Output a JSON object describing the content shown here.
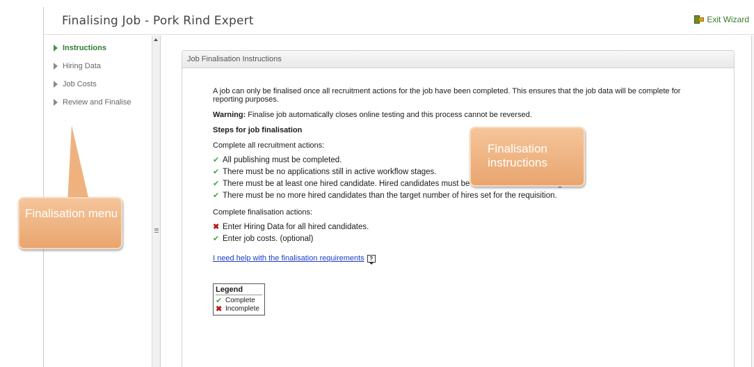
{
  "header": {
    "title": "Finalising Job - Pork Rind Expert",
    "exit_label": "Exit Wizard"
  },
  "sidebar": {
    "items": [
      {
        "label": "Instructions",
        "active": true
      },
      {
        "label": "Hiring Data",
        "active": false
      },
      {
        "label": "Job Costs",
        "active": false
      },
      {
        "label": "Review and Finalise",
        "active": false
      }
    ]
  },
  "panel": {
    "title": "Job Finalisation Instructions",
    "intro": "A job can only be finalised once all recruitment actions for the job have been completed. This ensures that the job data will be complete for reporting purposes.",
    "warning_label": "Warning:",
    "warning_text": " Finalise job automatically closes online testing and this process cannot be reversed.",
    "steps_heading": "Steps for job finalisation",
    "recruitment_heading": "Complete all recruitment actions:",
    "recruitment_items": [
      {
        "text": "All publishing must be completed.",
        "status": "complete"
      },
      {
        "text": "There must be no applications still in active workflow stages.",
        "status": "complete"
      },
      {
        "text": "There must be at least one hired candidate. Hired candidates must be in the 'Hire' workflow stage.",
        "status": "complete"
      },
      {
        "text": "There must be no more hired candidates than the target number of hires set for the requisition.",
        "status": "complete"
      }
    ],
    "finalisation_heading": "Complete finalisation actions:",
    "finalisation_items": [
      {
        "text": "Enter Hiring Data for all hired candidates.",
        "status": "incomplete"
      },
      {
        "text": "Enter job costs. (optional)",
        "status": "complete"
      }
    ],
    "help_link": "I need help with the finalisation requirements",
    "legend": {
      "title": "Legend",
      "complete": "Complete",
      "incomplete": "Incomplete"
    }
  },
  "callouts": {
    "menu": "Finalisation menu",
    "instructions": "Finalisation instructions"
  },
  "icons": {
    "check": "✔",
    "cross": "✖"
  },
  "colors": {
    "active_green": "#2e7d32",
    "check_green": "#3fa63f",
    "cross_red": "#b21a1a",
    "link_blue": "#1a3cc8",
    "callout_orange": "#e9a56f"
  }
}
